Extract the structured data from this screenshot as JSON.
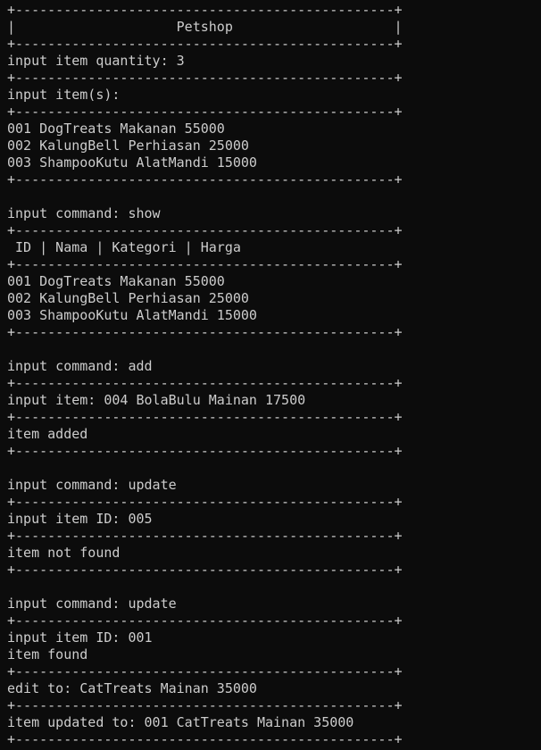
{
  "terminal": {
    "lines": [
      "+-----------------------------------------------+",
      "|                    Petshop                    |",
      "+-----------------------------------------------+",
      "input item quantity: 3",
      "+-----------------------------------------------+",
      "input item(s):",
      "+-----------------------------------------------+",
      "001 DogTreats Makanan 55000",
      "002 KalungBell Perhiasan 25000",
      "003 ShampooKutu AlatMandi 15000",
      "+-----------------------------------------------+",
      "",
      "input command: show",
      "+-----------------------------------------------+",
      " ID | Nama | Kategori | Harga",
      "+-----------------------------------------------+",
      "001 DogTreats Makanan 55000",
      "002 KalungBell Perhiasan 25000",
      "003 ShampooKutu AlatMandi 15000",
      "+-----------------------------------------------+",
      "",
      "input command: add",
      "+-----------------------------------------------+",
      "input item: 004 BolaBulu Mainan 17500",
      "+-----------------------------------------------+",
      "item added",
      "+-----------------------------------------------+",
      "",
      "input command: update",
      "+-----------------------------------------------+",
      "input item ID: 005",
      "+-----------------------------------------------+",
      "item not found",
      "+-----------------------------------------------+",
      "",
      "input command: update",
      "+-----------------------------------------------+",
      "input item ID: 001",
      "item found",
      "+-----------------------------------------------+",
      "edit to: CatTreats Mainan 35000",
      "+-----------------------------------------------+",
      "item updated to: 001 CatTreats Mainan 35000",
      "+-----------------------------------------------+"
    ]
  }
}
